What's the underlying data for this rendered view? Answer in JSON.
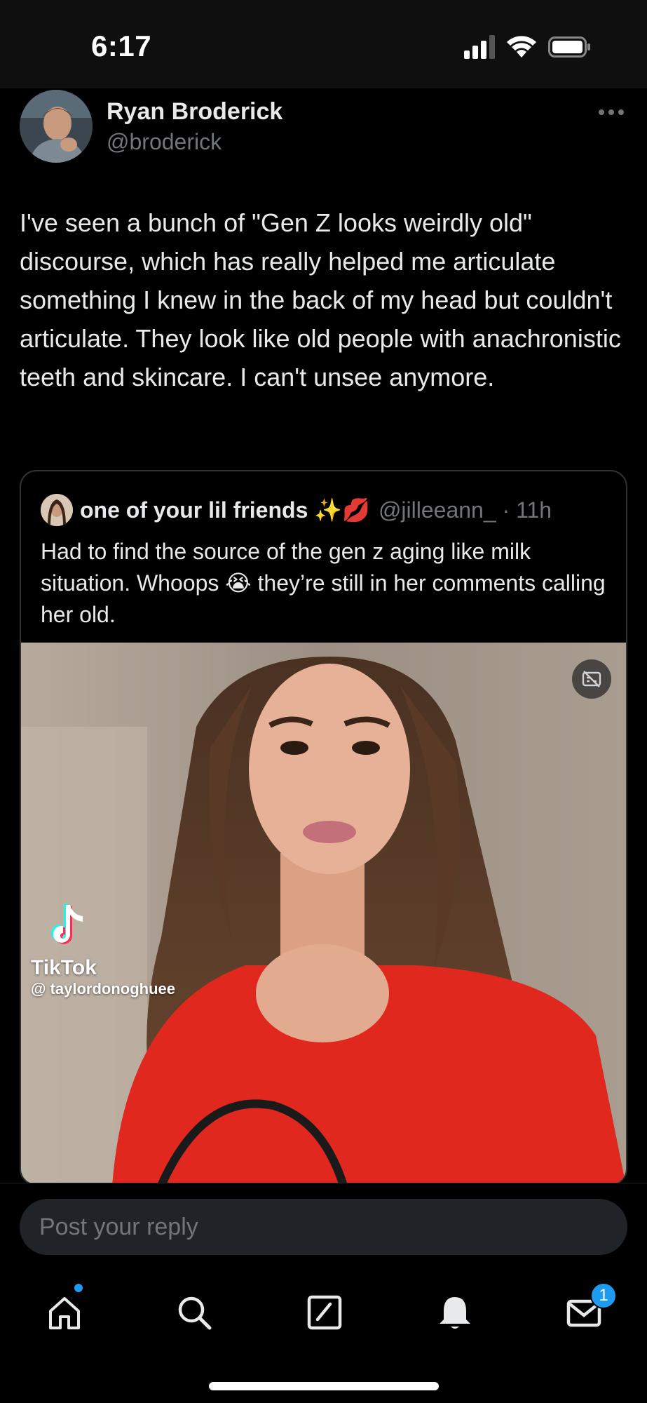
{
  "status_bar": {
    "time": "6:17"
  },
  "tweet": {
    "author_name": "Ryan Broderick",
    "author_handle": "@broderick",
    "text": "I've seen a bunch of \"Gen Z looks weirdly old\" discourse, which has really helped me articulate something I knew in the back of my head but couldn't articulate. They look like old people with anachronistic teeth and skincare. I can't unsee anymore."
  },
  "quote": {
    "author_name": "one of your lil friends ✨💋",
    "author_handle": "@jilleeann_ · 11h",
    "text": "Had to find the source of the gen z aging like milk situation. Whoops 😭 they’re still in her comments calling her old.",
    "media": {
      "watermark_brand": "TikTok",
      "watermark_handle": "@ taylordonoghuee"
    }
  },
  "reply": {
    "placeholder": "Post your reply"
  },
  "tab_bar": {
    "items": [
      "home-icon",
      "search-icon",
      "compose-icon",
      "notifications-icon",
      "messages-icon"
    ],
    "messages_badge": "1"
  },
  "colors": {
    "background": "#000000",
    "text": "#e7e9ea",
    "secondary_text": "#71767b",
    "accent": "#1d9bf0",
    "border": "#2f3336"
  }
}
